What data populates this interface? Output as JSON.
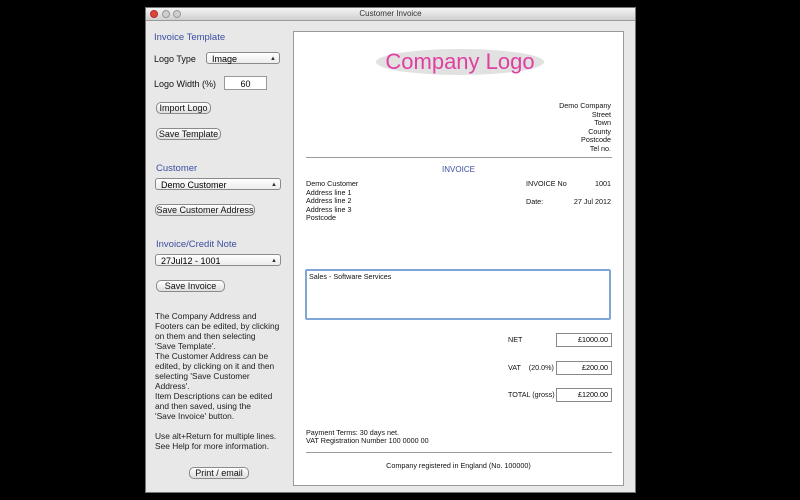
{
  "window": {
    "title": "Customer Invoice"
  },
  "left_panel": {
    "template_section": "Invoice Template",
    "logo_type_label": "Logo Type",
    "logo_type_value": "Image",
    "logo_width_label": "Logo Width (%)",
    "logo_width_value": "60",
    "import_logo_button": "Import Logo",
    "save_template_button": "Save Template",
    "customer_section": "Customer",
    "customer_value": "Demo Customer",
    "save_customer_button": "Save Customer Address",
    "invoice_section": "Invoice/Credit Note",
    "invoice_value": "27Jul12 - 1001",
    "save_invoice_button": "Save Invoice",
    "help_lines": [
      "The Company Address and",
      "Footers can be edited, by clicking",
      "on them and then selecting",
      "'Save Template'.",
      "The Customer Address can be",
      "edited, by clicking on it and then",
      "selecting 'Save Customer",
      "Address'.",
      "Item Descriptions can be edited",
      "and then saved, using the",
      "'Save Invoice' button."
    ],
    "help_lines_2": [
      "Use alt+Return for multiple lines.",
      "See Help for more information."
    ],
    "print_button": "Print / email"
  },
  "invoice": {
    "logo_text": "Company Logo",
    "company": [
      "Demo Company",
      "Street",
      "Town",
      "County",
      "Postcode",
      "Tel no."
    ],
    "heading": "INVOICE",
    "customer": [
      "Demo Customer",
      "Address line 1",
      "Address line 2",
      "Address line 3",
      "Postcode"
    ],
    "invoice_no_label": "INVOICE No",
    "invoice_no_value": "1001",
    "date_label": "Date:",
    "date_value": "27 Jul 2012",
    "item_description": "Sales - Software Services",
    "net_label": "NET",
    "net_value": "£1000.00",
    "vat_label": "VAT",
    "vat_rate": "(20.0%)",
    "vat_value": "£200.00",
    "total_label": "TOTAL (gross)",
    "total_value": "£1200.00",
    "payment_terms": "Payment Terms: 30 days net.",
    "vat_registration": "VAT Registration Number 100 0000 00",
    "footer": "Company registered in England (No. 100000)"
  },
  "colors": {
    "section_heading": "#3b4ea0",
    "logo": "#e040a0",
    "focus_border": "#7ea7d8"
  }
}
